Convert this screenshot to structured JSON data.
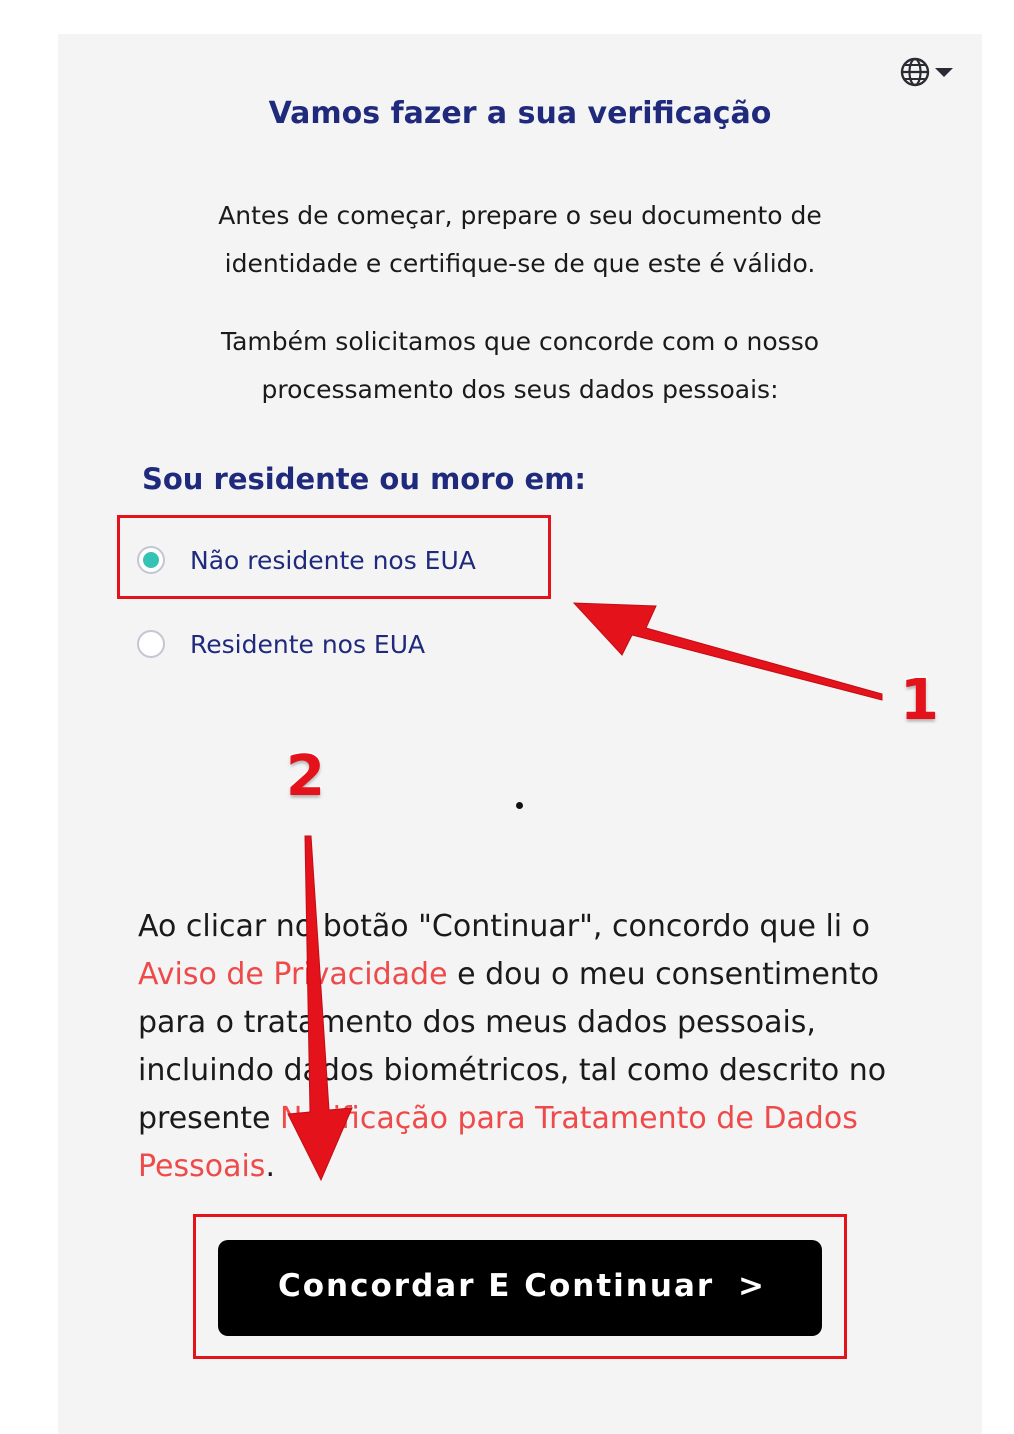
{
  "header": {
    "language_icon": "globe-icon",
    "dropdown_icon": "caret-down-icon",
    "title": "Vamos fazer a sua verificação"
  },
  "intro": {
    "paragraph1": "Antes de começar, prepare o seu documento de identidade e certifique-se de que este é válido.",
    "paragraph2": "Também solicitamos que concorde com o nosso processamento dos seus dados pessoais:"
  },
  "residency": {
    "label": "Sou residente ou moro em:",
    "options": [
      {
        "label": "Não residente nos EUA",
        "selected": true
      },
      {
        "label": "Residente nos EUA",
        "selected": false
      }
    ]
  },
  "consent": {
    "text1": "Ao clicar no botão \"Continuar\", concordo que li o ",
    "link1": "Aviso de Privacidade",
    "text2": " e dou o meu consentimento para o tratamento dos meus dados pessoais, incluindo dados biométricos, tal como descrito no presente ",
    "link2": "Notificação para Tratamento de Dados Pessoais",
    "text3": "."
  },
  "continue_button": {
    "label": "Concordar E Continuar",
    "chevron": ">"
  },
  "annotations": {
    "step1": "1",
    "step2": "2",
    "highlight_color": "#e3121b"
  },
  "colors": {
    "title": "#1f2a7c",
    "radio_selected": "#35c3b5",
    "link": "#ef4a4a",
    "button_bg": "#000000"
  }
}
